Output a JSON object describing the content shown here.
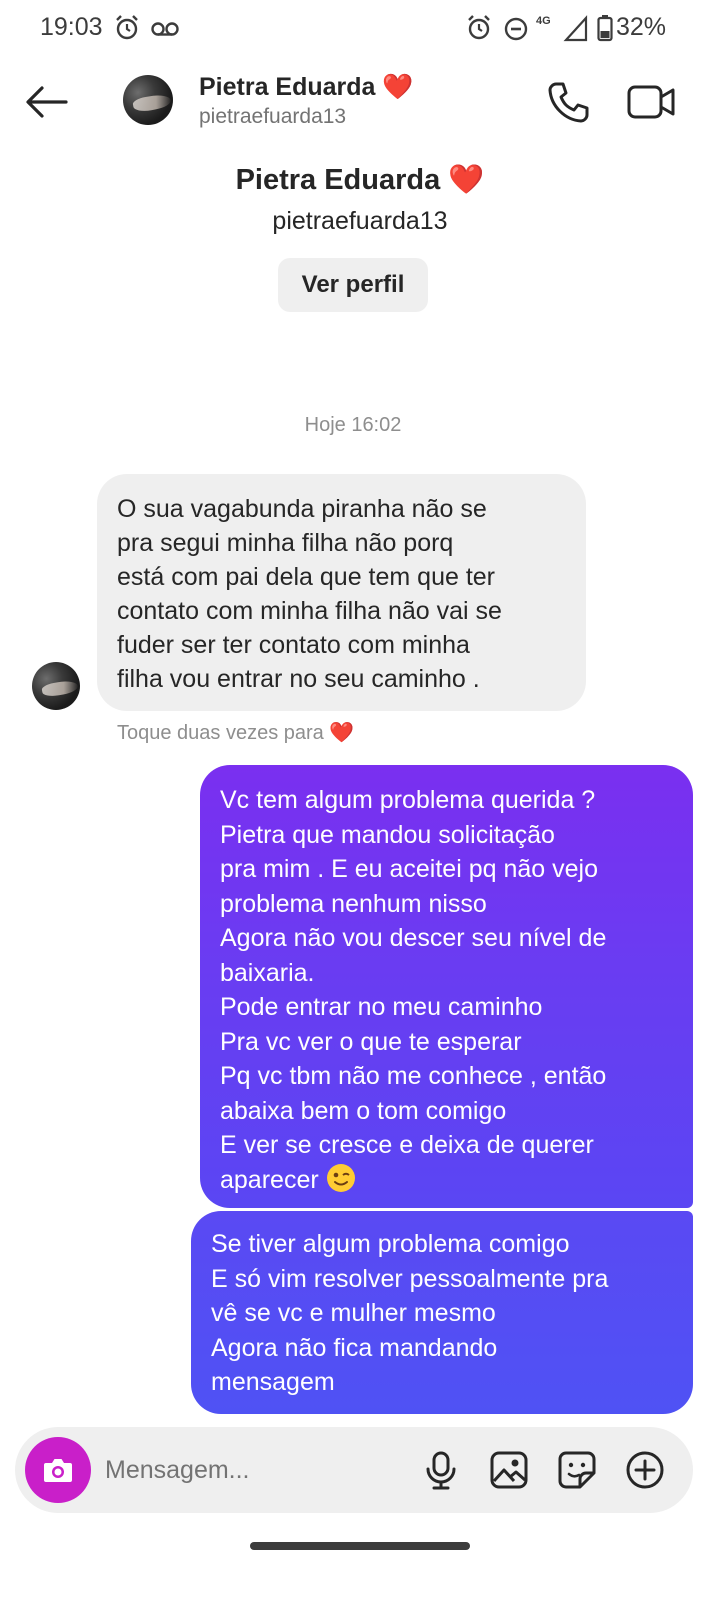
{
  "status_bar": {
    "time": "19:03",
    "network": "4G",
    "battery": "32%",
    "icons": [
      "alarm-icon",
      "voicemail-icon",
      "alarm-icon",
      "do-not-disturb-icon",
      "signal-icon",
      "battery-icon"
    ]
  },
  "header": {
    "contact_name": "Pietra Eduarda ❤️",
    "username": "pietraefuarda13",
    "icons": [
      "back-arrow-icon",
      "phone-icon",
      "video-camera-icon"
    ]
  },
  "profile": {
    "name": "Pietra Eduarda ❤️",
    "username": "pietraefuarda13",
    "view_profile_label": "Ver perfil"
  },
  "conversation": {
    "timestamp": "Hoje 16:02",
    "incoming": {
      "text": "O sua vagabunda piranha não se\npra segui minha filha não porq\nestá com pai dela que tem que ter\ncontato com minha filha não vai se\nfuder ser ter contato com minha\nfilha vou entrar no seu caminho ."
    },
    "react_hint": "Toque duas vezes para ❤️",
    "outgoing": [
      {
        "text": "Vc tem algum problema querida ?\nPietra que mandou solicitação\npra mim . E eu aceitei pq não vejo\nproblema nenhum nisso\nAgora não vou descer seu nível de\nbaixaria.\nPode entrar no meu caminho\nPra vc ver o que te esperar\nPq vc tbm não me  conhece , então\nabaixa bem o tom comigo\nE ver se cresce e deixa de querer\naparecer",
        "emoji": "winking-face-emoji"
      },
      {
        "text": "Se tiver algum problema comigo\nE só vim resolver pessoalmente pra\nvê se vc e mulher mesmo\nAgora não fica mandando\nmensagem"
      }
    ]
  },
  "composer": {
    "placeholder": "Mensagem...",
    "icons": [
      "camera-icon",
      "microphone-icon",
      "gallery-icon",
      "sticker-icon",
      "plus-circle-icon"
    ]
  },
  "colors": {
    "accent_camera": "#c91fc9",
    "outgoing_gradient_top": "#7a2ff0",
    "outgoing_gradient_bottom": "#4f52f4",
    "incoming_bubble": "#efefef"
  }
}
